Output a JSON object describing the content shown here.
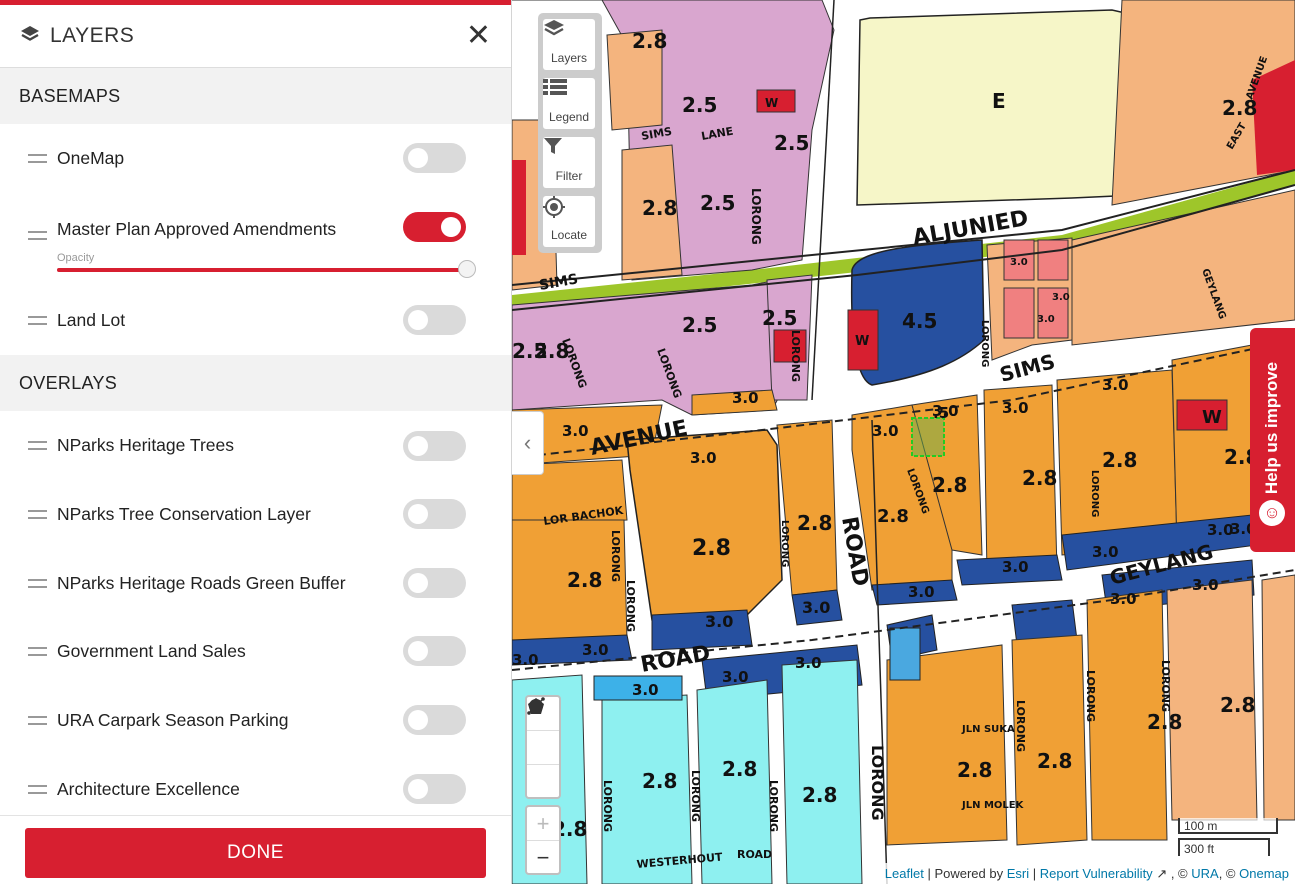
{
  "panel": {
    "title": "LAYERS",
    "basemaps_heading": "BASEMAPS",
    "basemaps": [
      {
        "label": "OneMap",
        "enabled": false
      },
      {
        "label": "Master Plan Approved Amendments",
        "enabled": true
      },
      {
        "label": "Land Lot",
        "enabled": false
      }
    ],
    "opacity_label": "Opacity",
    "opacity_value": 1.0,
    "overlays_heading": "OVERLAYS",
    "overlays": [
      {
        "label": "NParks Heritage Trees",
        "enabled": false
      },
      {
        "label": "NParks Tree Conservation Layer",
        "enabled": false
      },
      {
        "label": "NParks Heritage Roads Green Buffer",
        "enabled": false
      },
      {
        "label": "Government Land Sales",
        "enabled": false
      },
      {
        "label": "URA Carpark Season Parking",
        "enabled": false
      },
      {
        "label": "Architecture Excellence",
        "enabled": false
      }
    ],
    "done_label": "DONE"
  },
  "map": {
    "toolbar": {
      "layers": "Layers",
      "legend": "Legend",
      "filter": "Filter",
      "locate": "Locate"
    },
    "zoom_in": "+",
    "zoom_out": "−",
    "help_label": "Help us improve",
    "scale_metric": "100 m",
    "scale_imperial": "300 ft",
    "attribution": {
      "leaflet": "Leaflet",
      "powered_by": "| Powered by",
      "esri": "Esri",
      "report": "Report Vulnerability",
      "ura": "URA",
      "onemap": "Onemap"
    },
    "street_labels": [
      "ALJUNIED",
      "SIMS",
      "SIMS",
      "LANE",
      "SIMS",
      "AVENUE",
      "ROAD",
      "GEYLANG",
      "ROAD",
      "LORONG",
      "LORONG",
      "LORONG",
      "LORONG",
      "LORONG",
      "LORONG",
      "LORONG",
      "LORONG",
      "LORONG",
      "LORONG",
      "LOR BACHOK",
      "JLN SUKA",
      "JLN MOLEK",
      "WESTERHOUT",
      "ROAD",
      "EAST",
      "AVENUE",
      "GEYLANG",
      "LORONG",
      "LORONG",
      "LORONG",
      "LORONG",
      "LORONG",
      "LORONG",
      "LORONG"
    ],
    "zone_labels": [
      "2.8",
      "2.5",
      "W",
      "2.5",
      "2.8",
      "2.5",
      "E",
      "2.8",
      "3.0",
      "4.5",
      "W",
      "2.5",
      "2.5",
      "2.5",
      "3.0",
      "3.0",
      "3.0",
      "3.0",
      "3.0",
      "3.0",
      "3.0",
      "3.0",
      "3.0",
      "3.0",
      "W",
      "2.8",
      "2.8",
      "2.8",
      "2.8",
      "2.8",
      "2.8",
      "2.8",
      "2.8",
      "3.0",
      "3.0",
      "3.0",
      "3.0",
      "3.0",
      "3.0",
      "3.0",
      "3.0",
      "3.0",
      "3.0",
      "3.0",
      "3.0",
      "3.0",
      "2.8",
      "2.8",
      "2.8",
      "2.8",
      "2.8",
      "2.8",
      "2.8",
      "2.8",
      "2.8",
      ".5",
      "0"
    ]
  },
  "colors": {
    "brand_red": "#d71f30",
    "residential": "#f0a035",
    "commercial_pink": "#d9a6cf",
    "business_blue": "#2650a0",
    "open_space": "#f6f6c8",
    "light_blue": "#8ef0f0",
    "salmon": "#f4b47e"
  }
}
